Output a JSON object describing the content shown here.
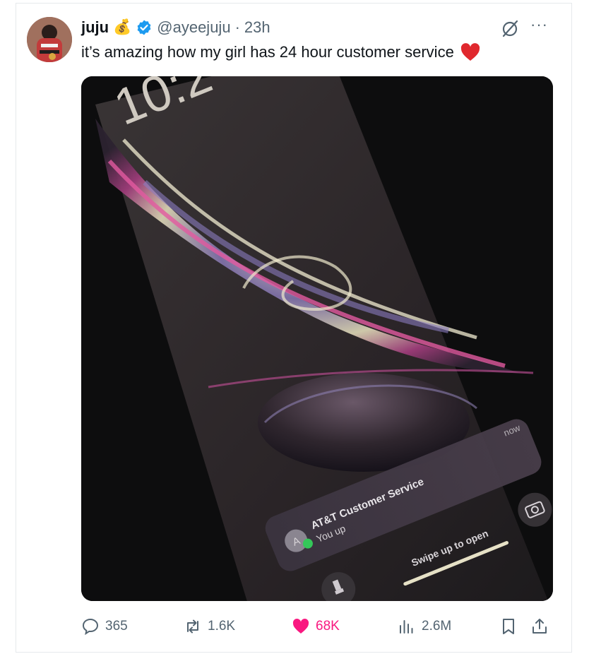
{
  "tweet": {
    "author_name": "juju",
    "name_emoji": "💰",
    "handle": "@ayeejuju",
    "separator": "·",
    "time": "23h",
    "text": "it’s amazing how my girl has 24 hour customer service",
    "text_emoji": "heart",
    "more": "···"
  },
  "photo": {
    "clock_fragment": "10:2",
    "notification_time": "now",
    "notification_title": "AT&T Customer Service",
    "notification_body": "You up",
    "avatar_letter": "A",
    "swipe_hint": "Swipe up to open"
  },
  "actions": {
    "replies": "365",
    "reposts": "1.6K",
    "likes": "68K",
    "views": "2.6M"
  },
  "colors": {
    "like": "#f91880",
    "verified": "#1d9bf0",
    "muted": "#536471"
  }
}
